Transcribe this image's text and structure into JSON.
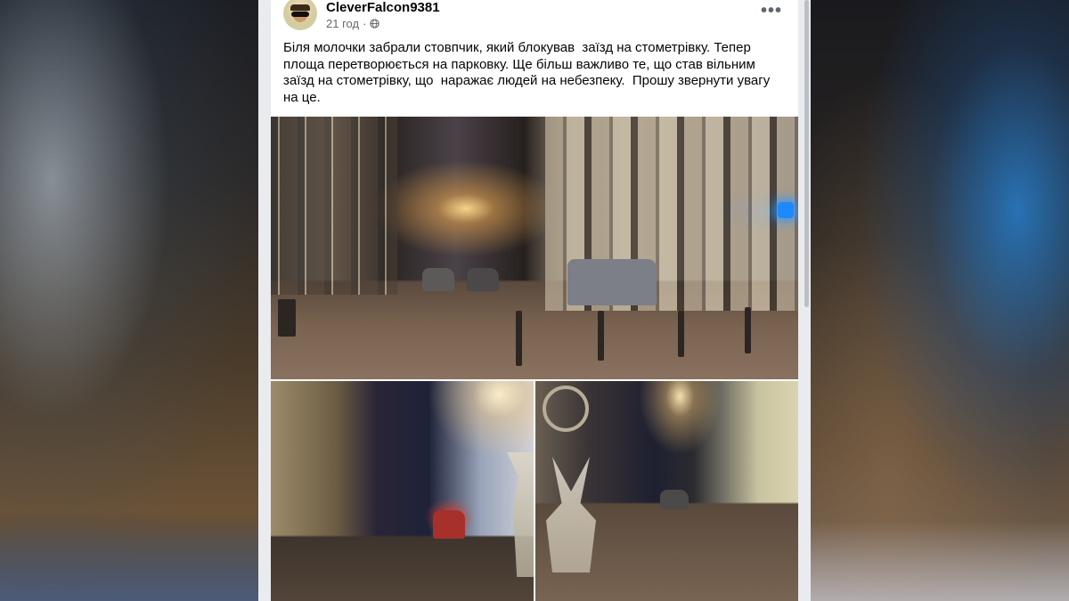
{
  "post": {
    "author": "CleverFalcon9381",
    "time": "21 год",
    "separator": "·",
    "audience_icon": "globe-icon",
    "more_label": "•••",
    "text": "Біля молочки забрали стовпчик, який блокував  заїзд на стометрівку. Тепер\nплоща перетворюється на парковку. Ще більш важливо те, що став вільним\nзаїзд на стометрівку, що  наражає людей на небезпеку.  Прошу звернути увагу\nна це.",
    "photos": [
      {
        "icon": "photo-night-street-bollards"
      },
      {
        "icon": "photo-night-street-lamps"
      },
      {
        "icon": "photo-night-square-sculpture"
      }
    ],
    "badge_icon": "apple-icon"
  },
  "colors": {
    "card_bg": "#ffffff",
    "text": "#050505",
    "secondary_text": "#65676b",
    "page_bg": "#e9ebee"
  }
}
